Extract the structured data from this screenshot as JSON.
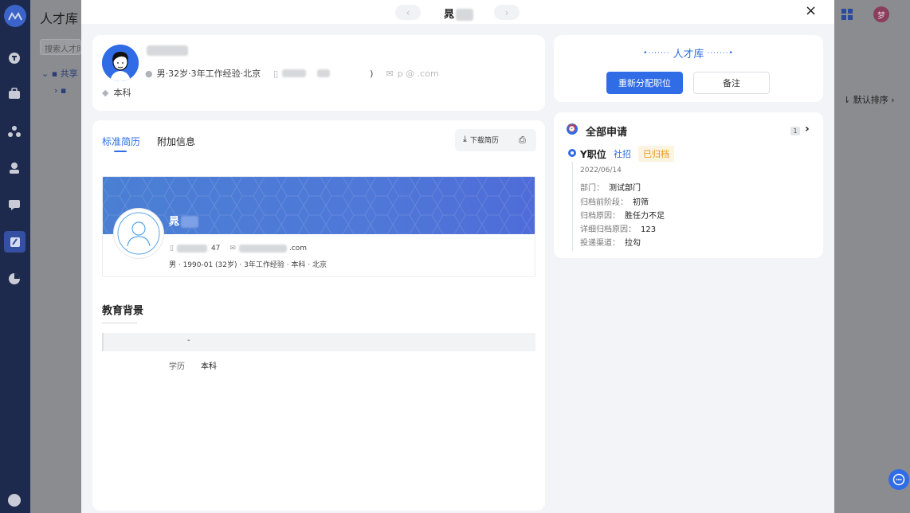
{
  "background": {
    "page_title": "人才库",
    "search_placeholder": "搜索人才库",
    "tree_item_1": "共享",
    "tree_item_2": "",
    "sort_label": "默认排序",
    "avatar_text": "梦"
  },
  "drawer": {
    "nav_prev": "‹",
    "nav_next": "›",
    "candidate_name": "晁",
    "close": "×"
  },
  "profile": {
    "name": "",
    "info": "男·32岁·3年工作经验·北京",
    "phone": ")",
    "email": "p    @      .com",
    "education": "本科"
  },
  "resume": {
    "tabs": [
      {
        "label": "标准简历",
        "active": true
      },
      {
        "label": "附加信息",
        "active": false
      }
    ],
    "download_label": "下载简历",
    "card_name": "晁",
    "card_phone": "47",
    "card_email": ".com",
    "card_summary": "男 · 1990-01 (32岁) · 3年工作经验 · 本科 · 北京",
    "education_title": "教育背景",
    "education_period": "-",
    "education_degree_key": "学历",
    "education_degree_value": "本科"
  },
  "talent_pool": {
    "title": "人才库",
    "reassign_button": "重新分配职位",
    "note_button": "备注"
  },
  "applications": {
    "title": "全部申请",
    "count": "1",
    "job_title": "Y职位",
    "job_type": "社招",
    "status": "已归档",
    "date": "2022/06/14",
    "fields": [
      {
        "label": "部门：",
        "value": "测试部门"
      },
      {
        "label": "归档前阶段：",
        "value": "初筛"
      },
      {
        "label": "归档原因：",
        "value": "胜任力不足"
      },
      {
        "label": "详细归档原因：",
        "value": "123"
      },
      {
        "label": "投递渠道：",
        "value": "拉勾"
      }
    ]
  },
  "colors": {
    "accent": "#2f6ce6",
    "archived_tag": "#e8941a",
    "sidebar": "#1d2a4d"
  }
}
